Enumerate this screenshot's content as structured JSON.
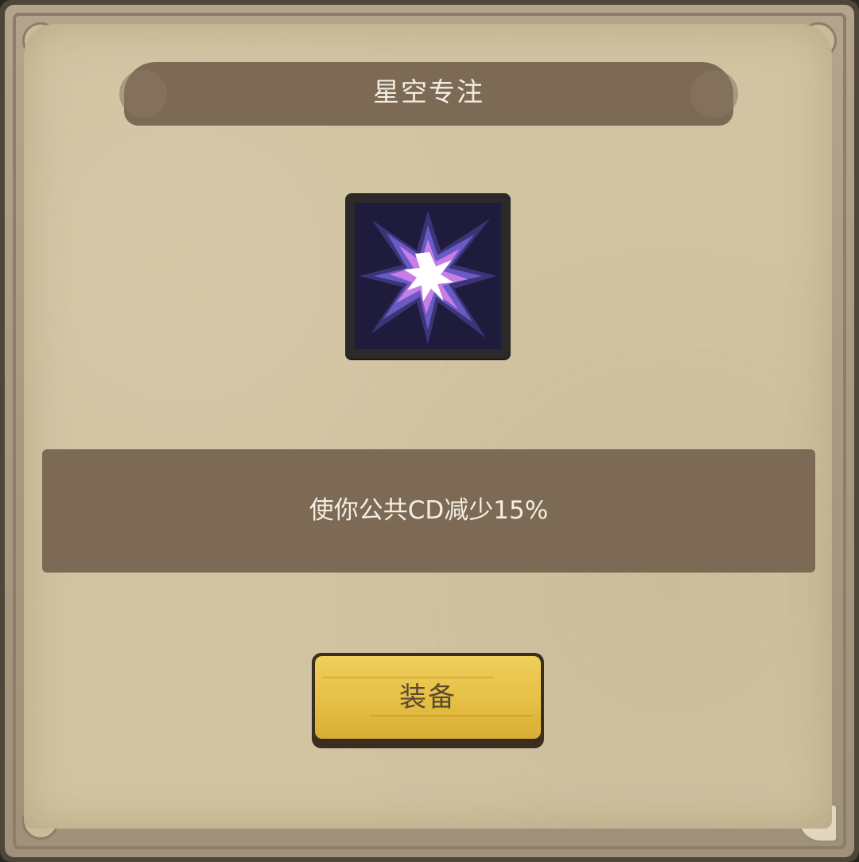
{
  "dialog": {
    "title": "星空专注",
    "description": "使你公共CD减少15%",
    "skill_icon": "purple-starburst-icon"
  },
  "actions": {
    "equip_label": "装备"
  },
  "colors": {
    "frame": "#4e463b",
    "parchment": "#d2c4a2",
    "ribbon": "#7c6a55",
    "button": "#e6bf45",
    "text_light": "#f3eee3",
    "text_dark": "#5a4a30"
  }
}
